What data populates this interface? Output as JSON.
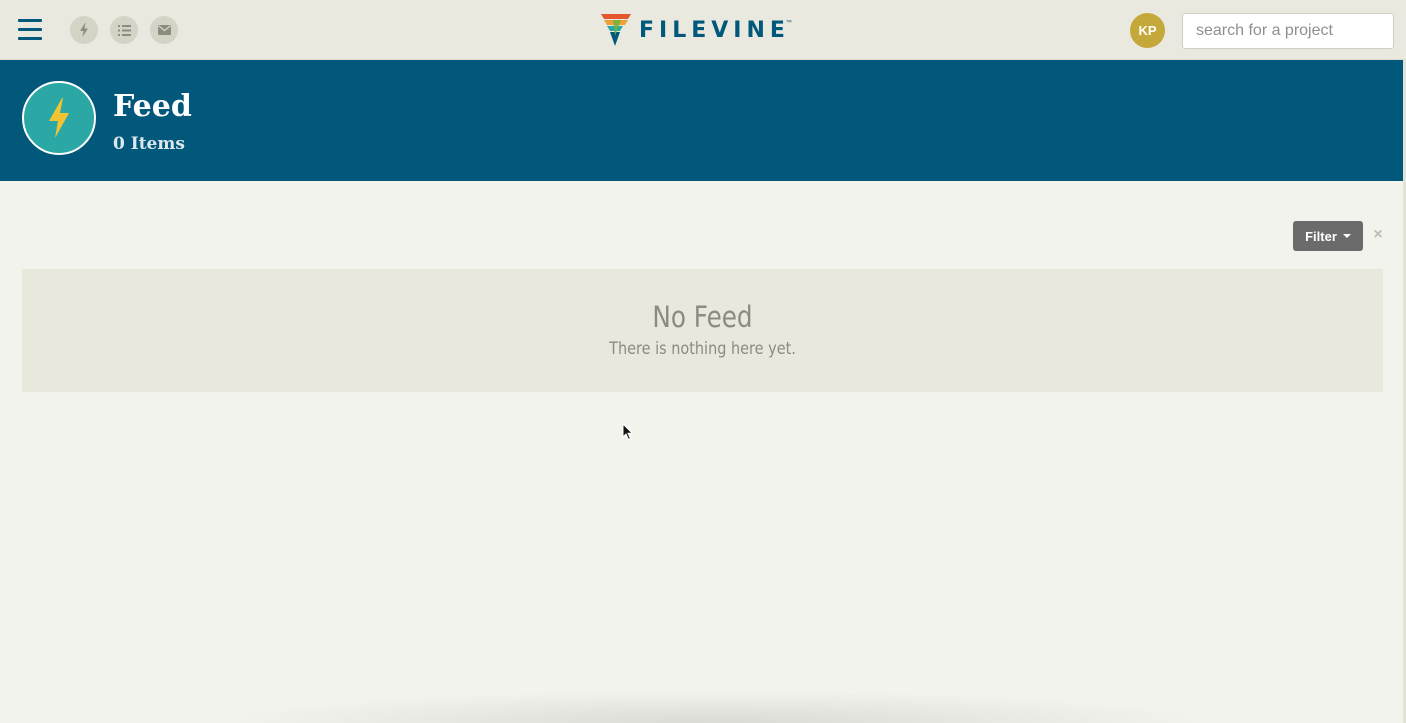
{
  "topbar": {
    "nav_icons": [
      {
        "name": "feed-icon"
      },
      {
        "name": "list-icon"
      },
      {
        "name": "mail-icon"
      }
    ],
    "logo_text": "FILEVINE",
    "logo_tm": "™",
    "avatar_initials": "KP",
    "search_placeholder": "search for a project"
  },
  "header": {
    "title": "Feed",
    "subtitle": "0 Items",
    "icon": "lightning-icon"
  },
  "controls": {
    "filter_label": "Filter",
    "clear_symbol": "×"
  },
  "empty_state": {
    "title": "No Feed",
    "message": "There is nothing here yet."
  },
  "colors": {
    "brand": "#02587a",
    "teal": "#2ba7a6",
    "avatar": "#c5a83a",
    "lightning": "#f2c433"
  }
}
